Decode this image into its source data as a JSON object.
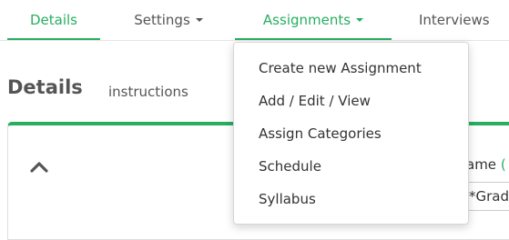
{
  "nav": {
    "tabs": [
      {
        "label": "Details",
        "active": true,
        "dropdown": false
      },
      {
        "label": "Settings",
        "active": false,
        "dropdown": true
      },
      {
        "label": "Assignments",
        "active": true,
        "dropdown": true
      },
      {
        "label": "Interviews",
        "active": false,
        "dropdown": false
      }
    ]
  },
  "page": {
    "title": "Details",
    "instructions_link": "instructions"
  },
  "card": {
    "collapse_icon": "chevron-up-icon",
    "field_label": "ame",
    "field_required_mark": "(",
    "field_value": "*Grad"
  },
  "assignments_menu": {
    "items": [
      "Create new Assignment",
      "Add / Edit / View",
      "Assign Categories",
      "Schedule",
      "Syllabus"
    ]
  },
  "colors": {
    "accent": "#27ae60",
    "text": "#333333",
    "muted_text": "#555555",
    "border": "#dddddd"
  }
}
